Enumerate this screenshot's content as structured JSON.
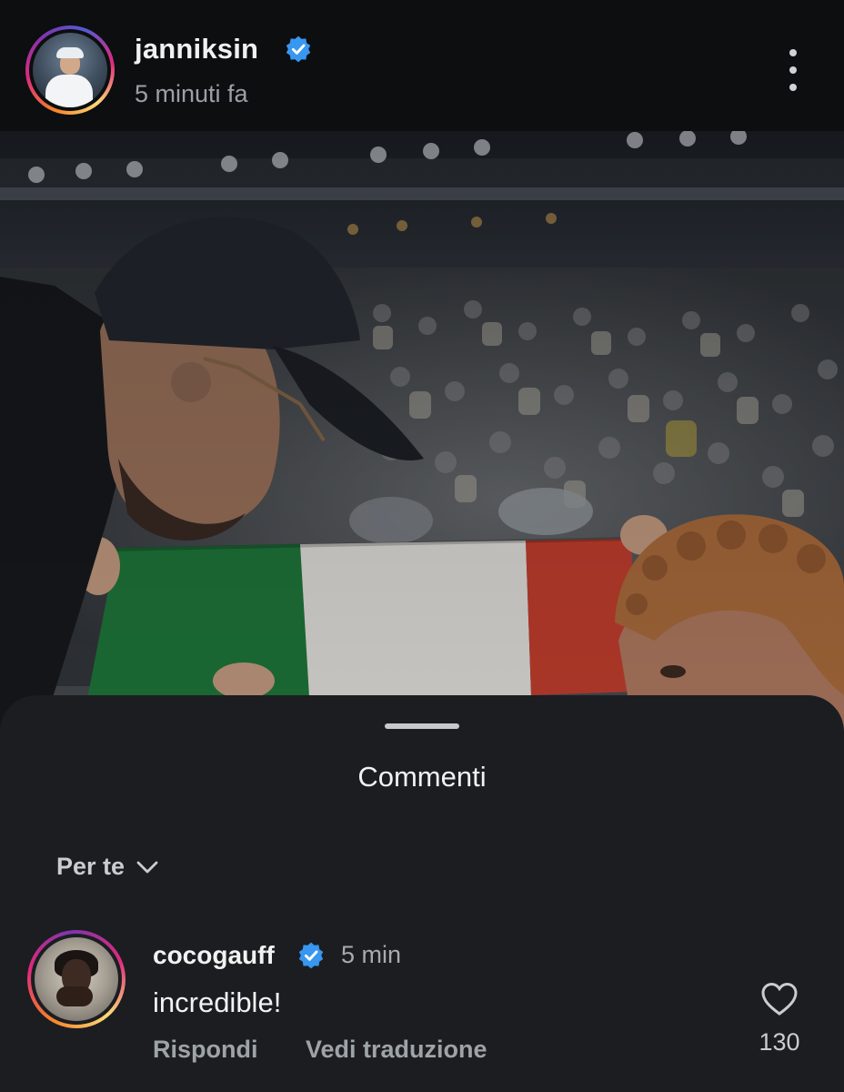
{
  "post": {
    "username": "janniksin",
    "verified": true,
    "timestamp": "5 minuti fa",
    "more_icon": "more-vertical-icon"
  },
  "photo": {
    "colors": {
      "flag_green": "#1f7a3c",
      "flag_white": "#e9e7e2",
      "flag_red": "#c8402f"
    }
  },
  "comments_sheet": {
    "title": "Commenti",
    "filter": {
      "label": "Per te",
      "icon": "chevron-down-icon"
    },
    "comments": [
      {
        "username": "cocogauff",
        "verified": true,
        "time": "5 min",
        "text": "incredible!",
        "reply_label": "Rispondi",
        "translate_label": "Vedi traduzione",
        "likes": "130",
        "like_icon": "heart-icon"
      }
    ]
  },
  "colors": {
    "verified_badge": "#3897f0",
    "sheet_background": "#1b1d21",
    "app_background": "#0d0e10"
  }
}
